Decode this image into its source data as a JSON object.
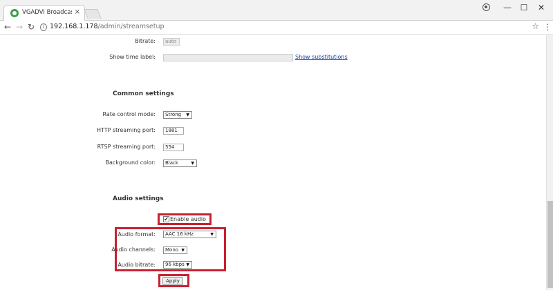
{
  "browser": {
    "tab_title": "VGADVI Broadcaster - st",
    "tab_close": "×",
    "url_host": "192.168.1.178",
    "url_path": "/admin/streamsetup",
    "window_controls": {
      "minimize": "—",
      "maximize": "☐",
      "close": "✕"
    },
    "nav": {
      "back": "←",
      "forward": "→",
      "reload": "↻"
    },
    "star": "☆",
    "menu": "⋮",
    "lock": "i"
  },
  "video": {
    "bitrate_label": "Bitrate:",
    "bitrate_value": "auto",
    "time_label_label": "Show time label:",
    "time_label_value": "",
    "show_substitutions": "Show substitutions"
  },
  "common": {
    "title": "Common settings",
    "rate_control_label": "Rate control mode:",
    "rate_control_value": "Strong",
    "http_port_label": "HTTP streaming port:",
    "http_port_value": "1881",
    "rtsp_port_label": "RTSP streaming port:",
    "rtsp_port_value": "554",
    "bg_color_label": "Background color:",
    "bg_color_value": "Black"
  },
  "audio": {
    "title": "Audio settings",
    "enable_label": "Enable audio",
    "enable_checked": "✔",
    "format_label": "Audio format:",
    "format_value": "AAC 16 kHz",
    "channels_label": "Audio channels:",
    "channels_value": "Mono",
    "bitrate_label": "Audio bitrate:",
    "bitrate_value": "96 kbps"
  },
  "apply_label": "Apply",
  "caret": "▼",
  "colors": {
    "highlight": "#c8202f",
    "link": "#1a3f9a"
  }
}
